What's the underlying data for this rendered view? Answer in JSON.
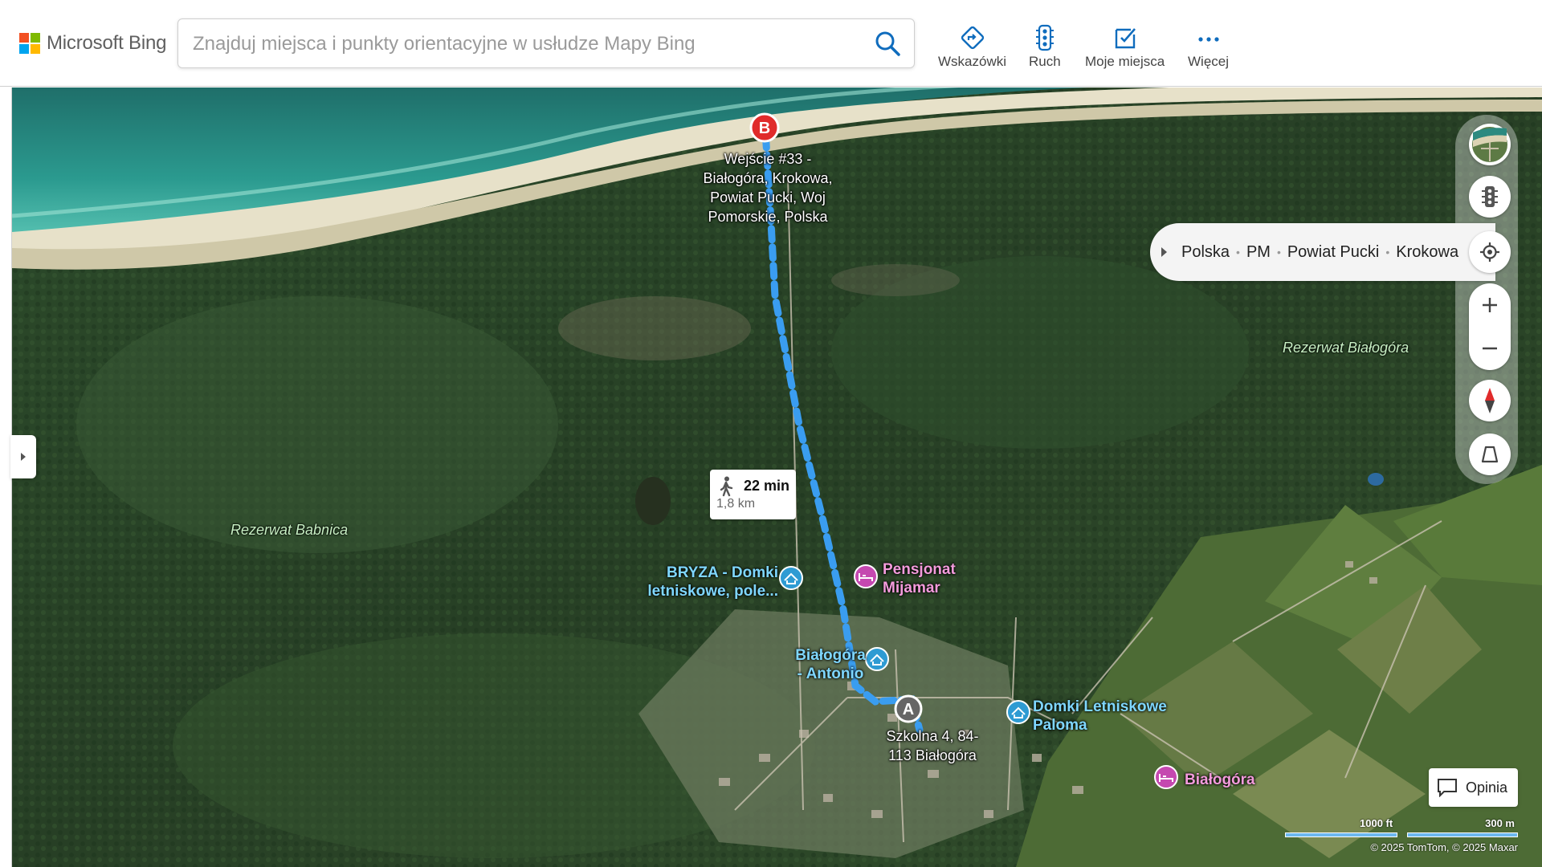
{
  "brand": {
    "name": "Microsoft Bing",
    "colors": [
      "#f25022",
      "#7fba00",
      "#00a4ef",
      "#ffb900"
    ]
  },
  "search": {
    "placeholder": "Znajduj miejsca i punkty orientacyjne w usłudze Mapy Bing",
    "value": ""
  },
  "nav": {
    "directions": "Wskazówki",
    "traffic": "Ruch",
    "my_places": "Moje miejsca",
    "more": "Więcej"
  },
  "route": {
    "start_marker": "A",
    "end_marker": "B",
    "start_address_line1": "Szkolna 4, 84-",
    "start_address_line2": "113 Białogóra",
    "end_address_line1": "Wejście #33 -",
    "end_address_line2": "Białogóra, Krokowa,",
    "end_address_line3": "Powiat Pucki, Woj",
    "end_address_line4": "Pomorskie, Polska",
    "duration": "22 min",
    "distance": "1,8 km",
    "mode": "walking",
    "color": "#3a9df0"
  },
  "labels": {
    "reserve_west": "Rezerwat Babnica",
    "reserve_east": "Rezerwat Białogóra"
  },
  "pois": {
    "bryza_line1": "BRYZA - Domki",
    "bryza_line2": "letniskowe, pole...",
    "mijamar_line1": "Pensjonat",
    "mijamar_line2": "Mijamar",
    "antonio_line1": "Białogóra",
    "antonio_line2": "- Antonio",
    "paloma_line1": "Domki Letniskowe",
    "paloma_line2": "Paloma",
    "bialogora": "Białogóra"
  },
  "breadcrumb": [
    "Polska",
    "PM",
    "Powiat Pucki",
    "Krokowa"
  ],
  "feedback": "Opinia",
  "scale": {
    "imperial": "1000 ft",
    "metric": "300 m"
  },
  "copyright": "© 2025 TomTom, © 2025 Maxar"
}
